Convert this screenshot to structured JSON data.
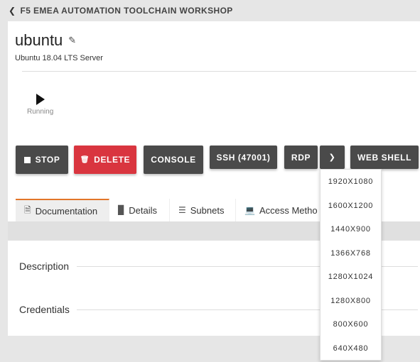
{
  "header": {
    "back_icon": "chevron-left-icon",
    "title": "F5 EMEA AUTOMATION TOOLCHAIN WORKSHOP"
  },
  "vm": {
    "name": "ubuntu",
    "edit_icon": "pencil-icon",
    "description": "Ubuntu 18.04 LTS Server",
    "status": "Running"
  },
  "actions": {
    "stop": "STOP",
    "delete": "DELETE",
    "console": "CONSOLE",
    "ssh": "SSH (47001)",
    "rdp": "RDP",
    "web_shell": "WEB SHELL"
  },
  "tabs": [
    {
      "label": "Documentation",
      "icon": "document-icon"
    },
    {
      "label": "Details",
      "icon": "bar-chart-icon"
    },
    {
      "label": "Subnets",
      "icon": "list-icon"
    },
    {
      "label": "Access Metho",
      "icon": "laptop-icon"
    }
  ],
  "sections": {
    "description": "Description",
    "credentials": "Credentials"
  },
  "rdp_resolutions": [
    "1920X1080",
    "1600X1200",
    "1440X900",
    "1366X768",
    "1280X1024",
    "1280X800",
    "800X600",
    "640X480"
  ],
  "colors": {
    "accent_tab": "#e2762a",
    "danger": "#d9353f",
    "button_dark": "#4a4a4a"
  }
}
